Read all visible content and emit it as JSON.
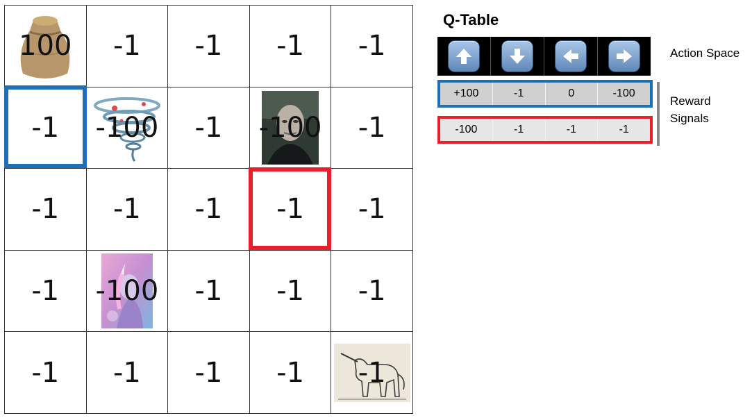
{
  "grid": {
    "rows": [
      [
        {
          "value": "100",
          "picture": "grain-sack"
        },
        {
          "value": "-1"
        },
        {
          "value": "-1"
        },
        {
          "value": "-1"
        },
        {
          "value": "-1"
        }
      ],
      [
        {
          "value": "-1"
        },
        {
          "value": "-100",
          "picture": "tornado"
        },
        {
          "value": "-1"
        },
        {
          "value": "-100",
          "picture": "villain-portrait"
        },
        {
          "value": "-1"
        }
      ],
      [
        {
          "value": "-1"
        },
        {
          "value": "-1"
        },
        {
          "value": "-1"
        },
        {
          "value": "-1"
        },
        {
          "value": "-1"
        }
      ],
      [
        {
          "value": "-1"
        },
        {
          "value": "-100",
          "picture": "unicorn-poster"
        },
        {
          "value": "-1"
        },
        {
          "value": "-1"
        },
        {
          "value": "-1"
        }
      ],
      [
        {
          "value": "-1"
        },
        {
          "value": "-1"
        },
        {
          "value": "-1"
        },
        {
          "value": "-1"
        },
        {
          "value": "-1",
          "picture": "unicorn-engraving"
        }
      ]
    ],
    "highlight_colors": {
      "blue": "#1f6fb6",
      "red": "#e8202a"
    }
  },
  "q_table": {
    "title": "Q-Table",
    "actions": [
      {
        "icon": "arrow-up-icon"
      },
      {
        "icon": "arrow-down-icon"
      },
      {
        "icon": "arrow-left-icon"
      },
      {
        "icon": "arrow-right-icon"
      }
    ],
    "action_label": "Action Space",
    "reward_label_line1": "Reward",
    "reward_label_line2": "Signals",
    "rows": [
      {
        "values": [
          "+100",
          "-1",
          "0",
          "-100"
        ],
        "border_color": "#1f6fb6"
      },
      {
        "values": [
          "-100",
          "-1",
          "-1",
          "-1"
        ],
        "border_color": "#e8202a"
      }
    ]
  }
}
